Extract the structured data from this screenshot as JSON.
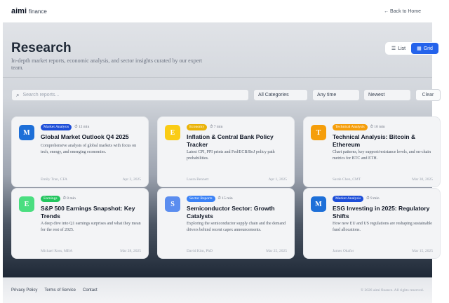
{
  "brand": {
    "main": "aimi",
    "sub": "finance"
  },
  "nav": {
    "back_label": "← Back to Home"
  },
  "header": {
    "title": "Research",
    "subtitle": "In-depth market reports, economic analysis, and sector insights curated by our expert team."
  },
  "view_toggle": {
    "list_label": "List",
    "grid_label": "Grid",
    "active": "Grid"
  },
  "filters": {
    "search_placeholder": "Search reports...",
    "category": "All Categories",
    "time": "Any time",
    "sort": "Newest",
    "clear_label": "Clear"
  },
  "cards": [
    {
      "avatar": "M",
      "avatar_color": "#1d6fd8",
      "tag": "Market Analysis",
      "tag_color": "#1d4ed8",
      "read_time": "12 min",
      "title": "Global Market Outlook Q4 2025",
      "desc": "Comprehensive analysis of global markets with focus on tech, energy, and emerging economies.",
      "author": "Emily Tran, CFA",
      "date": "Apr 2, 2025"
    },
    {
      "avatar": "E",
      "avatar_color": "#facc15",
      "tag": "Economy",
      "tag_color": "#eab308",
      "read_time": "7 min",
      "title": "Inflation & Central Bank Policy Tracker",
      "desc": "Latest CPI, PPI prints and Fed/ECB/BoJ policy path probabilities.",
      "author": "Laura Bennett",
      "date": "Apr 1, 2025"
    },
    {
      "avatar": "T",
      "avatar_color": "#f59e0b",
      "tag": "Technical Analysis",
      "tag_color": "#f59e0b",
      "read_time": "10 min",
      "title": "Technical Analysis: Bitcoin & Ethereum",
      "desc": "Chart patterns, key support/resistance levels, and on-chain metrics for BTC and ETH.",
      "author": "Sarah Chen, CMT",
      "date": "Mar 30, 2025"
    },
    {
      "avatar": "E",
      "avatar_color": "#4ade80",
      "tag": "Earnings",
      "tag_color": "#22c55e",
      "read_time": "8 min",
      "title": "S&P 500 Earnings Snapshot: Key Trends",
      "desc": "A deep dive into Q1 earnings surprises and what they mean for the rest of 2025.",
      "author": "Michael Ross, MBA",
      "date": "Mar 28, 2025"
    },
    {
      "avatar": "S",
      "avatar_color": "#5b8def",
      "tag": "Sector Reports",
      "tag_color": "#3b82f6",
      "read_time": "15 min",
      "title": "Semiconductor Sector: Growth Catalysts",
      "desc": "Exploring the semiconductor supply chain and the demand drivers behind recent capex announcements.",
      "author": "David Kim, PhD",
      "date": "Mar 25, 2025"
    },
    {
      "avatar": "M",
      "avatar_color": "#1d6fd8",
      "tag": "Market Analysis",
      "tag_color": "#1d4ed8",
      "read_time": "9 min",
      "title": "ESG Investing in 2025: Regulatory Shifts",
      "desc": "How new EU and US regulations are reshaping sustainable fund allocations.",
      "author": "James Okafor",
      "date": "Mar 15, 2025"
    }
  ],
  "footer": {
    "links": [
      "Privacy Policy",
      "Terms of Service",
      "Contact"
    ],
    "copyright": "© 2026 aimi finance. All rights reserved."
  }
}
